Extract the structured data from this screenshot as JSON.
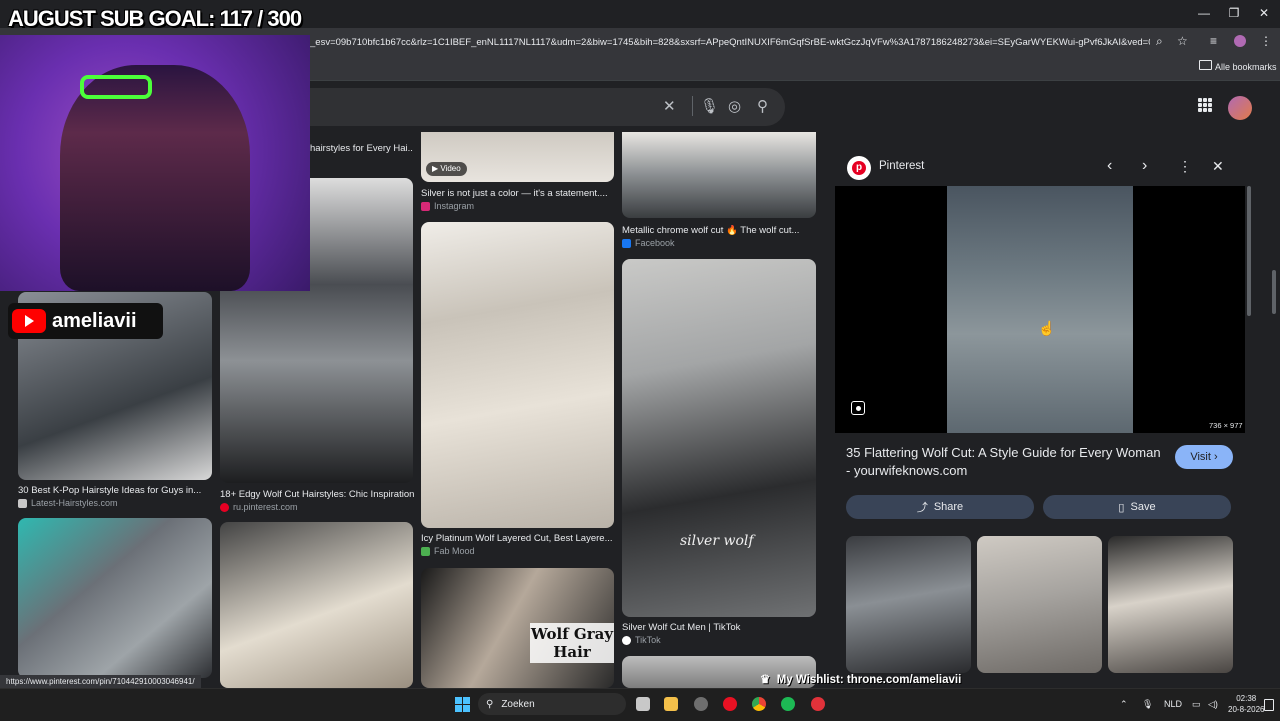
{
  "window": {
    "minimize": "—",
    "maximize": "❐",
    "close": "✕"
  },
  "browser": {
    "url": "_esv=09b710bfc1b67cc&rlz=1C1IBEF_enNL1117NL1117&udm=2&biw=1745&bih=828&sxsrf=APpeQntINUXIF6mGqfSrBE-wktGczJqVFw%3A1787186248273&ei=SEyGarWYEKWui-gPvf6JkAI&ved=0ah...",
    "bookmarks_label": "Alle bookmarks"
  },
  "overlay": {
    "goal": "AUGUST SUB GOAL: 117 / 300",
    "channel": "ameliavii",
    "wishlist": "My Wishlist: throne.com/ameliavii"
  },
  "results": {
    "col1": [
      {
        "caption": "30 Best K-Pop Hairstyle Ideas for Guys in...",
        "source": "Latest-Hairstyles.com",
        "color": "#c8c8c8"
      }
    ],
    "col2": [
      {
        "caption": "hairstyles for Every Hai...",
        "source": ""
      },
      {
        "caption": "18+ Edgy Wolf Cut Hairstyles: Chic Inspiration",
        "source": "ru.pinterest.com",
        "color": "#e60023"
      }
    ],
    "col3": [
      {
        "badge": "Video",
        "caption": "Silver is not just a color — it's a statement....",
        "source": "Instagram",
        "color": "#d62976"
      },
      {
        "caption": "Icy Platinum Wolf Layered Cut, Best Layere...",
        "source": "Fab Mood",
        "color": "#4caf50"
      },
      {
        "overlay_text": "Wolf Gray Hair"
      }
    ],
    "col4": [
      {
        "caption": "Metallic chrome wolf cut 🔥 The wolf cut...",
        "source": "Facebook",
        "color": "#1877f2"
      },
      {
        "overlay_text": "silver wolf",
        "caption": "Silver Wolf Cut Men | TikTok",
        "source": "TikTok",
        "color": "#ffffff"
      }
    ]
  },
  "panel": {
    "source": "Pinterest",
    "dimensions": "736 × 977",
    "title": "35 Flattering Wolf Cut: A Style Guide for Every Woman - yourwifeknows.com",
    "visit": "Visit",
    "share": "Share",
    "save": "Save"
  },
  "status_url": "https://www.pinterest.com/pin/710442910003046941/",
  "taskbar": {
    "search": "Zoeken",
    "language": "NLD",
    "time": "02:38",
    "date": "20-8-2026"
  }
}
